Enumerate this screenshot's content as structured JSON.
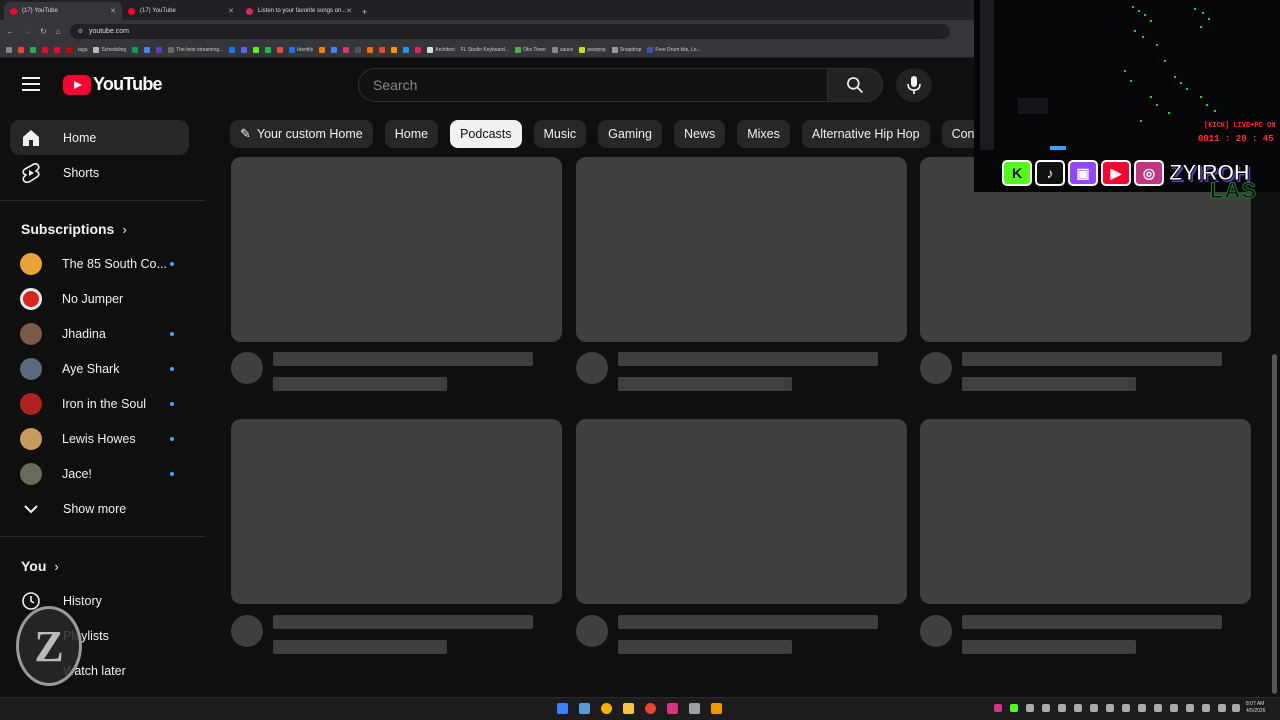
{
  "browser": {
    "tabs": [
      {
        "title": "(17) YouTube",
        "active": true
      },
      {
        "title": "(17) YouTube",
        "active": false
      },
      {
        "title": "Listen to your favorite songs on...",
        "active": false
      }
    ],
    "new_tab": "+",
    "url": "youtube.com",
    "bookmarks": [
      "tags",
      "Scheduling",
      "The best streaming...",
      "Identify",
      "Architect",
      "FL Studio Keyboard...",
      "Obs Timer",
      "sauce",
      "pearpop",
      "Snapdrop",
      "Free Drum kits, Lo..."
    ]
  },
  "header": {
    "logo_text": "YouTube",
    "search_placeholder": "Search"
  },
  "sidebar": {
    "home": "Home",
    "shorts": "Shorts",
    "subscriptions_title": "Subscriptions",
    "subscriptions": [
      {
        "name": "The 85 South Co...",
        "new": true,
        "color": "#e8a23a"
      },
      {
        "name": "No Jumper",
        "new": false,
        "color": "#d9261c"
      },
      {
        "name": "Jhadina",
        "new": true,
        "color": "#7a5a48"
      },
      {
        "name": "Aye Shark",
        "new": true,
        "color": "#5a6a7a"
      },
      {
        "name": "Iron in the Soul",
        "new": true,
        "color": "#b02020"
      },
      {
        "name": "Lewis Howes",
        "new": true,
        "color": "#c99a5a"
      },
      {
        "name": "Jace!",
        "new": true,
        "color": "#6a6a5a"
      }
    ],
    "show_more": "Show more",
    "you_title": "You",
    "you_items": [
      "History",
      "Playlists",
      "Watch later"
    ]
  },
  "chips": [
    {
      "label": "Your custom Home",
      "selected": false,
      "icon": "wand-icon"
    },
    {
      "label": "Home",
      "selected": false
    },
    {
      "label": "Podcasts",
      "selected": true
    },
    {
      "label": "Music",
      "selected": false
    },
    {
      "label": "Gaming",
      "selected": false
    },
    {
      "label": "News",
      "selected": false
    },
    {
      "label": "Mixes",
      "selected": false
    },
    {
      "label": "Alternative Hip Hop",
      "selected": false
    },
    {
      "label": "Cons",
      "selected": false
    }
  ],
  "stream_overlay": {
    "live_text": "[KICK] LIVE+PC ON",
    "timer": "0011 : 28 : 45",
    "handle": "ZYIROH",
    "social_icons": [
      "kick-icon",
      "tiktok-icon",
      "twitch-icon",
      "youtube-icon",
      "instagram-icon"
    ],
    "banner_text": "LAS"
  },
  "watermark": "Z",
  "taskbar": {
    "time": "8:07 AM",
    "date": "4/5/2026"
  },
  "colors": {
    "yt_red": "#ff0033",
    "skeleton": "#3f3f3f",
    "background": "#0f0f0f",
    "new_dot": "#3ea6ff"
  }
}
